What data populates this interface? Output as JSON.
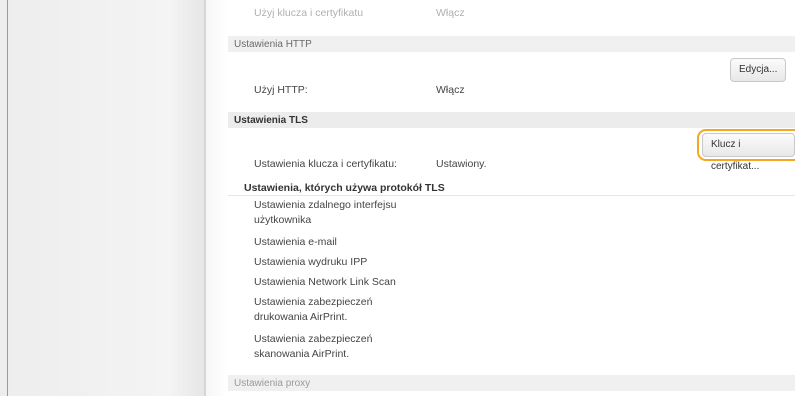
{
  "top_row": {
    "label": "Użyj klucza i certyfikatu",
    "value": "Włącz"
  },
  "http_section": {
    "title": "Ustawienia HTTP",
    "edit_button": "Edycja...",
    "use_http_label": "Użyj HTTP:",
    "use_http_value": "Włącz"
  },
  "tls_section": {
    "title": "Ustawienia TLS",
    "key_cert_button": "Klucz i certyfikat...",
    "key_cert_label": "Ustawienia klucza i certyfikatu:",
    "key_cert_value": "Ustawiony.",
    "uses_tls_heading": "Ustawienia, których używa protokół TLS",
    "tls_items": [
      {
        "line1": "Ustawienia zdalnego interfejsu",
        "line2": "użytkownika"
      },
      {
        "line1": "Ustawienia e-mail",
        "line2": ""
      },
      {
        "line1": "Ustawienia wydruku IPP",
        "line2": ""
      },
      {
        "line1": "Ustawienia Network Link Scan",
        "line2": ""
      },
      {
        "line1": "Ustawienia zabezpieczeń",
        "line2": "drukowania AirPrint."
      },
      {
        "line1": "Ustawienia zabezpieczeń",
        "line2": "skanowania AirPrint."
      }
    ]
  },
  "proxy_section": {
    "title": "Ustawienia proxy"
  },
  "colors": {
    "highlight": "#f5a623",
    "section_bg": "#ececec"
  }
}
